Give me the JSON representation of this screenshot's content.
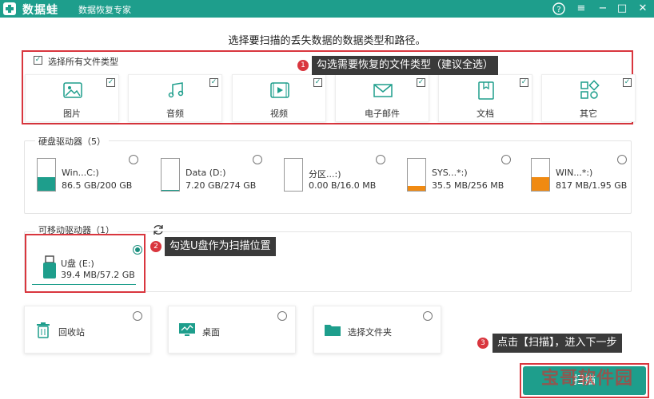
{
  "app": {
    "brand": "数据蛙",
    "subtitle": "数据恢复专家",
    "window_controls": {
      "help": "?",
      "menu": "≡",
      "minimize": "−",
      "maximize": "□",
      "close": "✕"
    }
  },
  "instruction": "选择要扫描的丢失数据的数据类型和路径。",
  "file_types": {
    "select_all_label": "选择所有文件类型",
    "items": [
      {
        "label": "图片",
        "icon": "image-icon"
      },
      {
        "label": "音频",
        "icon": "music-icon"
      },
      {
        "label": "视频",
        "icon": "video-icon"
      },
      {
        "label": "电子邮件",
        "icon": "mail-icon"
      },
      {
        "label": "文档",
        "icon": "document-icon"
      },
      {
        "label": "其它",
        "icon": "other-icon"
      }
    ]
  },
  "hdd": {
    "title": "硬盘驱动器（5）",
    "drives": [
      {
        "name": "Win...C:)",
        "size": "86.5 GB/200 GB",
        "fill": 0.43,
        "color": "#1e9e8c"
      },
      {
        "name": "Data (D:)",
        "size": "7.20 GB/274 GB",
        "fill": 0.03,
        "color": "#1e9e8c"
      },
      {
        "name": "分区...:)",
        "size": "0.00  B/16.0 MB",
        "fill": 0.0,
        "color": "#1e9e8c"
      },
      {
        "name": "SYS...*:)",
        "size": "35.5 MB/256 MB",
        "fill": 0.14,
        "color": "#f08a12"
      },
      {
        "name": "WIN...*:)",
        "size": "817 MB/1.95 GB",
        "fill": 0.42,
        "color": "#f08a12"
      }
    ]
  },
  "removable": {
    "title": "可移动驱动器（1）",
    "drive": {
      "name": "U盘 (E:)",
      "size": "39.4 MB/57.2 GB"
    }
  },
  "locations": [
    {
      "label": "回收站",
      "icon": "trash-icon"
    },
    {
      "label": "桌面",
      "icon": "desktop-icon"
    },
    {
      "label": "选择文件夹",
      "icon": "folder-icon"
    }
  ],
  "callouts": {
    "one": {
      "num": "1",
      "text": "勾选需要恢复的文件类型（建议全选）"
    },
    "two": {
      "num": "2",
      "text": "勾选U盘作为扫描位置"
    },
    "three": {
      "num": "3",
      "text": "点击【扫描】，进入下一步"
    }
  },
  "scan_button": "扫描",
  "watermark": "宝哥软件园"
}
